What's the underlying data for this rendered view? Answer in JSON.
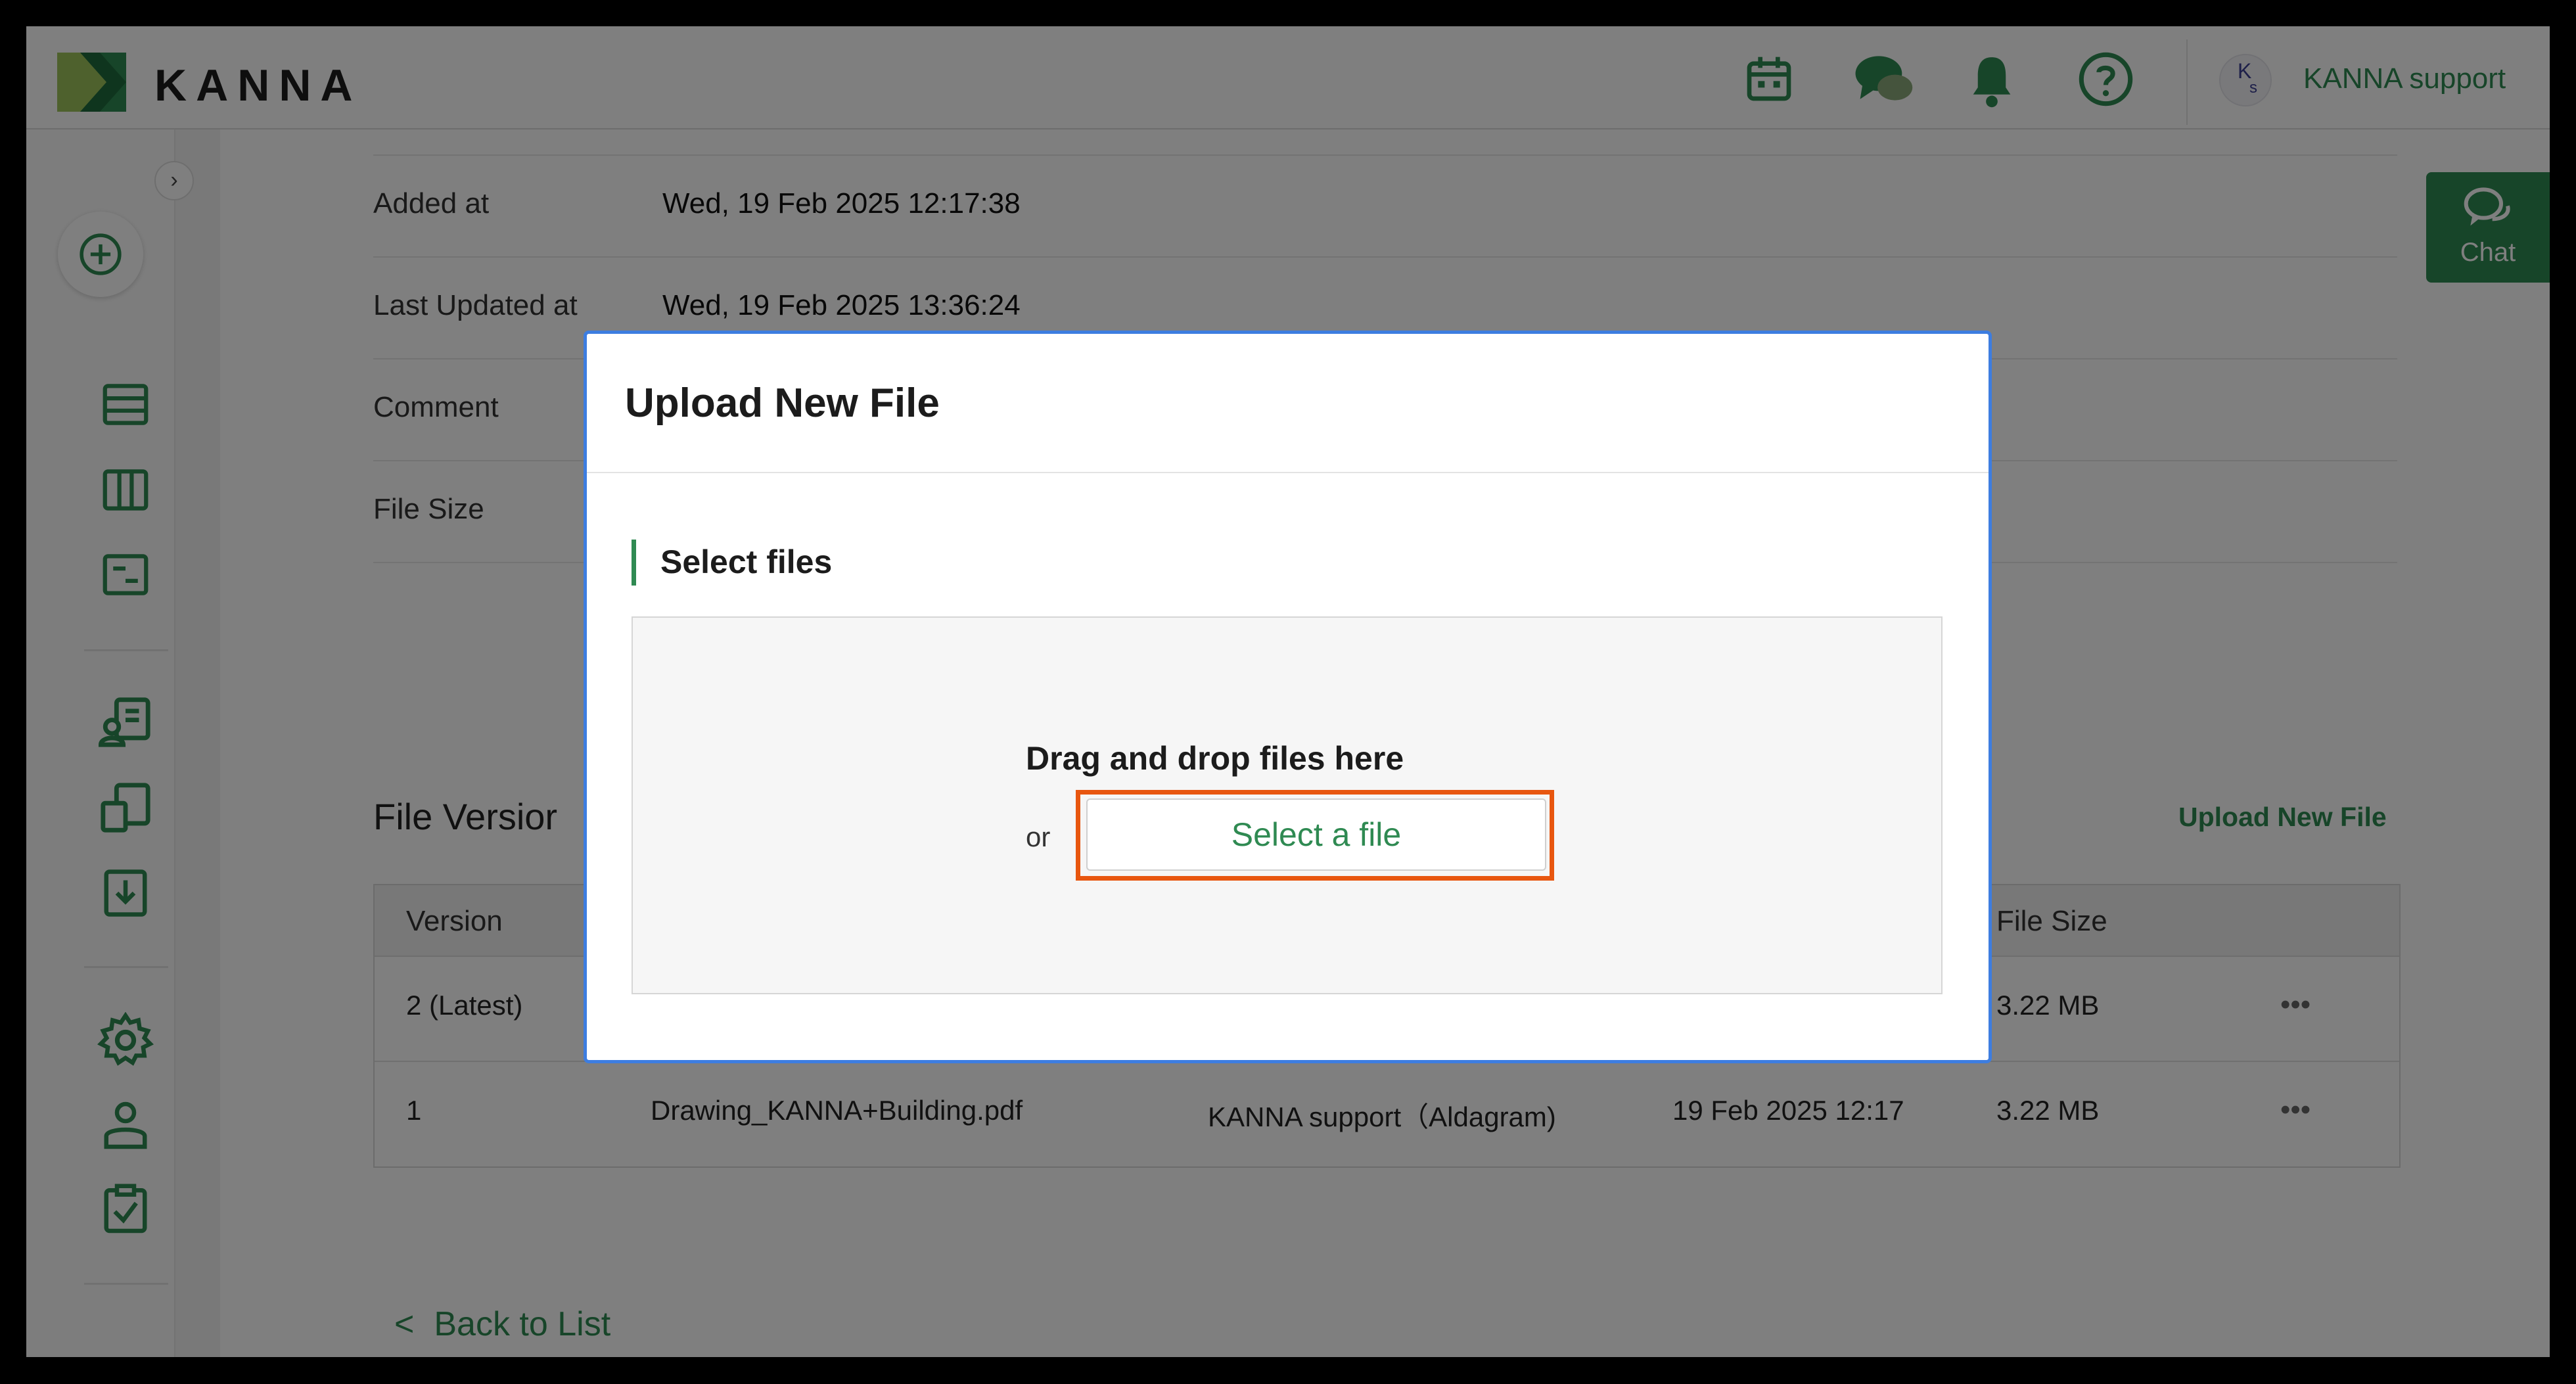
{
  "header": {
    "brand": "KANNA",
    "user_initial_top": "K",
    "user_initial_bottom": "s",
    "user_name": "KANNA support",
    "icons": [
      "calendar-icon",
      "chat-bubbles-icon",
      "bell-icon",
      "help-icon"
    ]
  },
  "sidebar": {
    "collapse_glyph": "›",
    "icons": [
      "add-circle-icon",
      "list-icon",
      "columns-icon",
      "document-icon",
      "contacts-icon",
      "reports-icon",
      "download-icon",
      "gear-icon",
      "user-icon",
      "checklist-icon"
    ]
  },
  "details": {
    "added_label": "Added at",
    "added_value": "Wed, 19 Feb 2025 12:17:38",
    "updated_label": "Last Updated at",
    "updated_value": "Wed, 19 Feb 2025 13:36:24",
    "comment_label": "Comment",
    "size_label": "File Size"
  },
  "versions": {
    "title": "File Versior",
    "upload_link": "Upload New File",
    "headers": {
      "version": "Version",
      "file_size": "File Size"
    },
    "rows": [
      {
        "version": "2 (Latest)",
        "file": "",
        "uploader": "",
        "date": "",
        "size": "3.22 MB",
        "more": "•••"
      },
      {
        "version": "1",
        "file": "Drawing_KANNA+Building.pdf",
        "uploader": "KANNA support（Aldagram)",
        "date": "19 Feb 2025 12:17",
        "size": "3.22 MB",
        "more": "•••"
      }
    ]
  },
  "back_link": "Back to List",
  "chat_button": "Chat",
  "modal": {
    "title": "Upload New File",
    "section": "Select files",
    "drop_text": "Drag and drop files here",
    "or_text": "or",
    "select_button": "Select a file"
  },
  "colors": {
    "accent": "#2f8a52",
    "highlight": "#e8560f",
    "modal_border": "#3d7de0"
  }
}
